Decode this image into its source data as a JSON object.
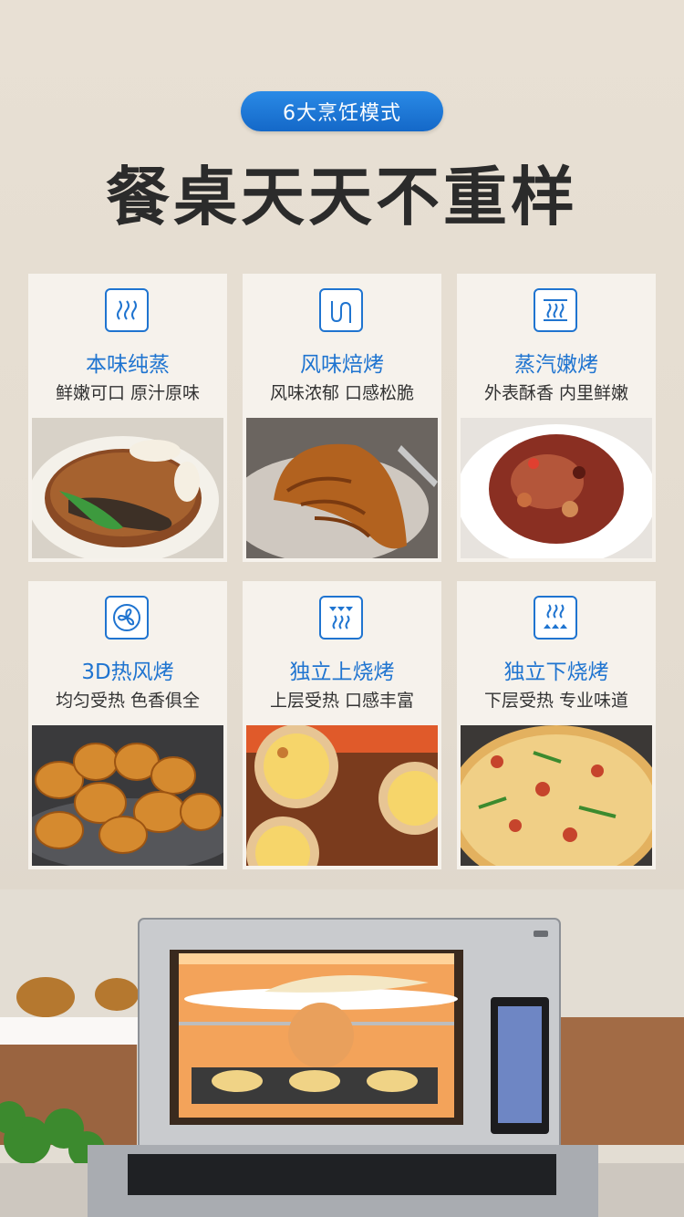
{
  "badge": "6大烹饪模式",
  "headline": "餐桌天天不重样",
  "cards": [
    {
      "title": "本味纯蒸",
      "subtitle": "鲜嫩可口 原汁原味",
      "icon": "steam-icon",
      "photo": "steamed-sea-cucumber-photo"
    },
    {
      "title": "风味焙烤",
      "subtitle": "风味浓郁 口感松脆",
      "icon": "bake-icon",
      "photo": "croissant-photo"
    },
    {
      "title": "蒸汽嫩烤",
      "subtitle": "外表酥香 内里鲜嫩",
      "icon": "steam-bake-icon",
      "photo": "roasted-meat-photo"
    },
    {
      "title": "3D热风烤",
      "subtitle": "均匀受热 色香俱全",
      "icon": "fan-icon",
      "photo": "roasted-potatoes-photo"
    },
    {
      "title": "独立上烧烤",
      "subtitle": "上层受热 口感丰富",
      "icon": "top-heat-icon",
      "photo": "egg-tarts-photo"
    },
    {
      "title": "独立下烧烤",
      "subtitle": "下层受热 专业味道",
      "icon": "bottom-heat-icon",
      "photo": "pizza-photo"
    }
  ],
  "colors": {
    "accent": "#1f74d0",
    "background": "#e6dfd3",
    "card": "#f6f2ec"
  }
}
